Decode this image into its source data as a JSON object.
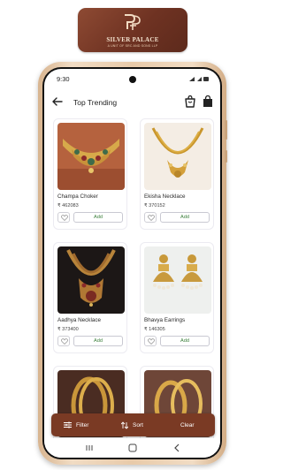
{
  "brand": {
    "name": "SILVER PALACE",
    "tagline": "A UNIT OF SRC AND SONS LLP",
    "banner_color": "#6e3222"
  },
  "statusbar": {
    "time": "9:30"
  },
  "appbar": {
    "title": "Top Trending"
  },
  "products": [
    {
      "name": "Champa Choker",
      "price": "₹ 462083",
      "add_label": "Add",
      "image": "gold-choker-image"
    },
    {
      "name": "Ekisha Necklace",
      "price": "₹ 370152",
      "add_label": "Add",
      "image": "gold-necklace-image"
    },
    {
      "name": "Aadhya Necklace",
      "price": "₹ 373400",
      "add_label": "Add",
      "image": "temple-necklace-image"
    },
    {
      "name": "Bhavya Earrings",
      "price": "₹ 146305",
      "add_label": "Add",
      "image": "jhumka-earrings-image"
    },
    {
      "name": "",
      "price": "",
      "add_label": "",
      "image": "gold-bangles-image"
    },
    {
      "name": "",
      "price": "",
      "add_label": "",
      "image": "gold-bangle-pair-image"
    }
  ],
  "bottom_bar": {
    "filter_label": "Filter",
    "sort_label": "Sort",
    "clear_label": "Clear",
    "color": "#7a3a24"
  },
  "colors": {
    "add_text": "#3a7f3a",
    "phone_frame": "#e8caa9"
  }
}
